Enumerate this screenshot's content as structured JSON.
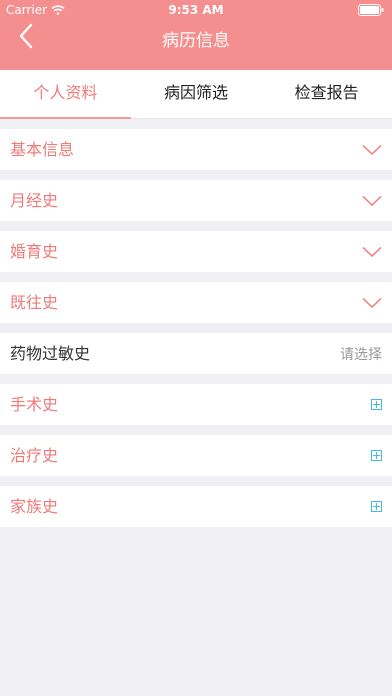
{
  "status_bar": {
    "carrier": "Carrier",
    "time": "9:53 AM"
  },
  "nav": {
    "title": "病历信息"
  },
  "tabs": [
    {
      "label": "个人资料",
      "active": true
    },
    {
      "label": "病因筛选",
      "active": false
    },
    {
      "label": "检查报告",
      "active": false
    }
  ],
  "rows": [
    {
      "label": "基本信息",
      "type": "expand"
    },
    {
      "label": "月经史",
      "type": "expand"
    },
    {
      "label": "婚育史",
      "type": "expand"
    },
    {
      "label": "既往史",
      "type": "expand"
    },
    {
      "label": "药物过敏史",
      "type": "select",
      "placeholder": "请选择"
    },
    {
      "label": "手术史",
      "type": "add"
    },
    {
      "label": "治疗史",
      "type": "add"
    },
    {
      "label": "家族史",
      "type": "add"
    }
  ],
  "colors": {
    "primary": "#f58f8f",
    "label": "#f07a7a",
    "add_icon": "#4ab8d8",
    "background": "#efeff4"
  }
}
